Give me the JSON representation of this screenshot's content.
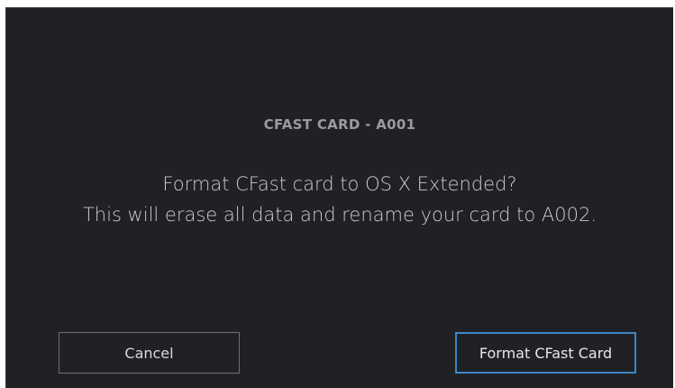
{
  "dialog": {
    "card_title": "CFAST CARD - A001",
    "message_line1": "Format CFast card to OS X Extended?",
    "message_line2": "This will erase all data and rename your card to A002.",
    "cancel_label": "Cancel",
    "confirm_label": "Format CFast Card"
  },
  "colors": {
    "background": "#202124",
    "title": "#9a9b9d",
    "text": "#c9cacc",
    "accent_border": "#3f86c9",
    "secondary_border": "#6e6f72"
  }
}
